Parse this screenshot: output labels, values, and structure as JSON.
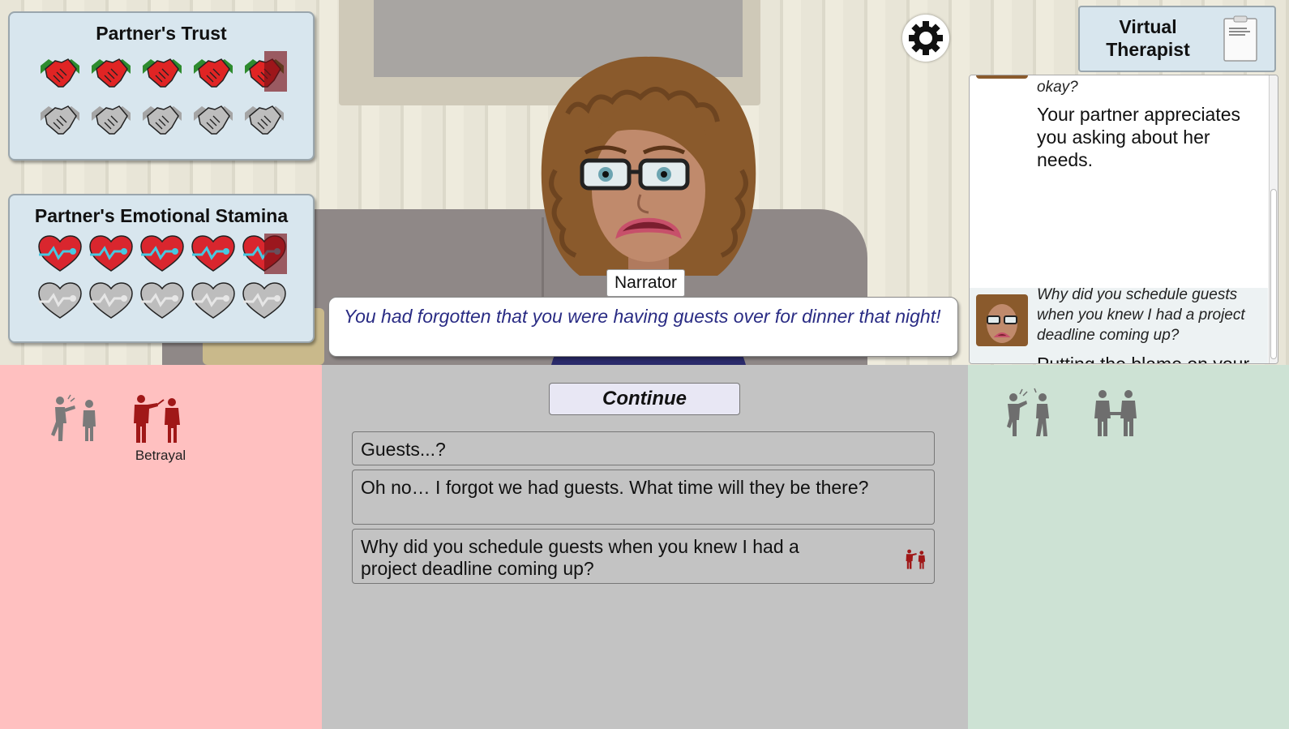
{
  "stats": {
    "trust": {
      "title": "Partner's Trust",
      "value": 4.5,
      "max": 5,
      "icon": "handshake-icon",
      "filled_color": "#e02424",
      "empty_color": "#bdbdbd"
    },
    "stamina": {
      "title": "Partner's Emotional Stamina",
      "value": 4.5,
      "max": 5,
      "icon": "heartbeat-icon",
      "filled_color": "#d9262e",
      "empty_color": "#bdbdbd"
    }
  },
  "settings": {
    "icon": "gear-icon"
  },
  "therapist": {
    "label": "Virtual Therapist",
    "icon": "clipboard-icon",
    "log": [
      {
        "quote": "okay?",
        "feedback": "Your partner appreciates you asking about her needs."
      },
      {
        "quote": "Why did you schedule guests when you knew I had a project deadline coming up?",
        "feedback": "Putting the blame on your partner will engender feelings of betrayal."
      }
    ]
  },
  "narration": {
    "speaker": "Narrator",
    "text": "You had forgotten that you were having guests over for dinner that night!"
  },
  "categories": {
    "negative": [
      {
        "name": "contempt",
        "icon": "yelling-figures-icon",
        "label": "",
        "color": "#777777"
      },
      {
        "name": "betrayal",
        "icon": "stabbing-figures-icon",
        "label": "Betrayal",
        "color": "#a01818"
      }
    ],
    "positive": [
      {
        "name": "repair",
        "icon": "reaching-figures-icon",
        "label": "",
        "color": "#6e6e6e"
      },
      {
        "name": "connection",
        "icon": "holding-hands-figures-icon",
        "label": "",
        "color": "#6e6e6e"
      }
    ]
  },
  "continue_label": "Continue",
  "choices": [
    {
      "text": "Guests...?",
      "style": "grey"
    },
    {
      "text": "Oh no… I forgot we had guests. What time will they be there?",
      "style": "grey"
    },
    {
      "text": "Why did you schedule guests when you knew I had a project deadline coming up?",
      "style": "highlight",
      "icon": "betrayal-icon"
    }
  ]
}
